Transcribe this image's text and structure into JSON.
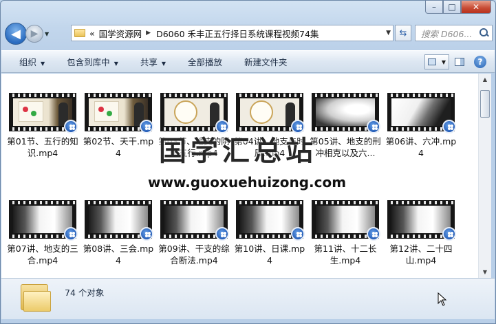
{
  "window": {
    "caption": {
      "minimize": "–",
      "maximize": "□",
      "close": "✕"
    }
  },
  "nav": {
    "back_label": "◀",
    "forward_label": "▶",
    "address": {
      "overflow": "«",
      "segments": [
        "国学资源网",
        "D6060 禾丰正五行择日系统课程视频74集"
      ]
    },
    "refresh_label": "⇆",
    "search": {
      "placeholder": "搜索 D606..."
    }
  },
  "toolbar": {
    "organize": "组织",
    "include_library": "包含到库中",
    "share": "共享",
    "play_all": "全部播放",
    "new_folder": "新建文件夹"
  },
  "files": [
    {
      "name": "第01节、五行的知识.mp4",
      "thumb": "lecture"
    },
    {
      "name": "第02节、天干.mp4",
      "thumb": "lecture"
    },
    {
      "name": "第03节、地支的阴阳五行.mp4",
      "thumb": "dial"
    },
    {
      "name": "第04讲、地支与时辰.mp4",
      "thumb": "dial"
    },
    {
      "name": "第05讲、地支的刑冲相克以及六...",
      "thumb": "ink"
    },
    {
      "name": "第06讲、六冲.mp4",
      "thumb": "ink2"
    },
    {
      "name": "第07讲、地支的三合.mp4",
      "thumb": "ink3"
    },
    {
      "name": "第08讲、三会.mp4",
      "thumb": "ink3"
    },
    {
      "name": "第09讲、干支的综合断法.mp4",
      "thumb": "ink3"
    },
    {
      "name": "第10讲、日课.mp4",
      "thumb": "ink3"
    },
    {
      "name": "第11讲、十二长生.mp4",
      "thumb": "ink3"
    },
    {
      "name": "第12讲、二十四山.mp4",
      "thumb": "ink3"
    }
  ],
  "watermark": {
    "title": "国学汇总站",
    "url": "www.guoxuehuizong.com"
  },
  "details": {
    "count": "74 个对象"
  }
}
